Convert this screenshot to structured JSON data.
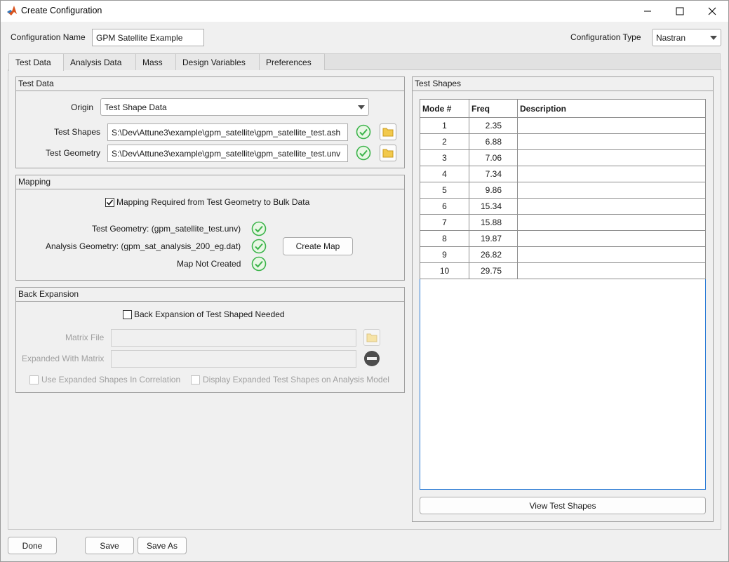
{
  "window": {
    "title": "Create Configuration"
  },
  "header": {
    "config_name_label": "Configuration Name",
    "config_name_value": "GPM Satellite Example",
    "config_type_label": "Configuration Type",
    "config_type_value": "Nastran"
  },
  "tabs": [
    {
      "label": "Test Data",
      "active": true
    },
    {
      "label": "Analysis Data",
      "active": false
    },
    {
      "label": "Mass",
      "active": false
    },
    {
      "label": "Design Variables",
      "active": false
    },
    {
      "label": "Preferences",
      "active": false
    }
  ],
  "test_data": {
    "title": "Test Data",
    "origin_label": "Origin",
    "origin_value": "Test Shape Data",
    "shapes_label": "Test Shapes",
    "shapes_path": "S:\\Dev\\Attune3\\example\\gpm_satellite\\gpm_satellite_test.ash",
    "geometry_label": "Test Geometry",
    "geometry_path": "S:\\Dev\\Attune3\\example\\gpm_satellite\\gpm_satellite_test.unv"
  },
  "mapping": {
    "title": "Mapping",
    "required_label": "Mapping Required from Test Geometry to Bulk Data",
    "required_checked": true,
    "test_geometry_status": "Test Geometry: (gpm_satellite_test.unv)",
    "analysis_geometry_status": "Analysis Geometry: (gpm_sat_analysis_200_eg.dat)",
    "map_status": "Map Not Created",
    "create_map_label": "Create Map"
  },
  "back_expansion": {
    "title": "Back Expansion",
    "needed_label": "Back Expansion of Test Shaped Needed",
    "needed_checked": false,
    "matrix_file_label": "Matrix File",
    "expanded_with_label": "Expanded With Matrix",
    "use_expanded_label": "Use Expanded Shapes In Correlation",
    "display_expanded_label": "Display Expanded Test Shapes on Analysis Model"
  },
  "test_shapes": {
    "title": "Test Shapes",
    "columns": [
      "Mode #",
      "Freq",
      "Description"
    ],
    "rows": [
      [
        "1",
        "2.35",
        ""
      ],
      [
        "2",
        "6.88",
        ""
      ],
      [
        "3",
        "7.06",
        ""
      ],
      [
        "4",
        "7.34",
        ""
      ],
      [
        "5",
        "9.86",
        ""
      ],
      [
        "6",
        "15.34",
        ""
      ],
      [
        "7",
        "15.88",
        ""
      ],
      [
        "8",
        "19.87",
        ""
      ],
      [
        "9",
        "26.82",
        ""
      ],
      [
        "10",
        "29.75",
        ""
      ]
    ],
    "view_button_label": "View Test Shapes"
  },
  "footer": {
    "done_label": "Done",
    "save_label": "Save",
    "save_as_label": "Save As"
  },
  "colors": {
    "ok_green": "#3cb44b",
    "folder_yellow": "#f2c94c",
    "table_border_blue": "#2b7bd6"
  }
}
